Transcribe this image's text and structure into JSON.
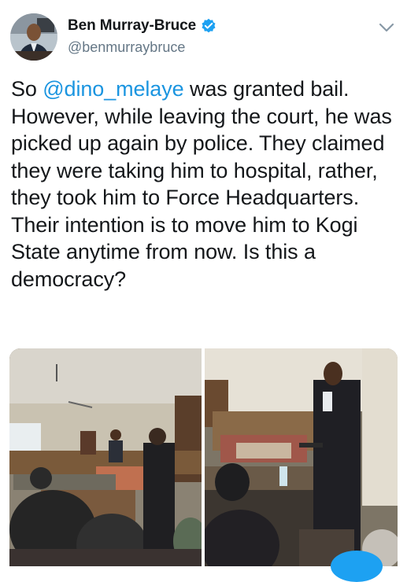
{
  "author": {
    "display_name": "Ben Murray-Bruce",
    "handle": "@benmurraybruce",
    "verified": true,
    "avatar_icon": "profile-photo"
  },
  "menu": {
    "icon": "chevron-down-icon"
  },
  "tweet": {
    "text_before": "So ",
    "mention": "@dino_melaye",
    "text_after": " was granted bail. However, while leaving the court, he was picked up again by police. They claimed they were taking him to hospital, rather, they took him to Force Headquarters. Their intention is to move him to Kogi State anytime from now. Is this a democracy?"
  },
  "media": {
    "photos": [
      {
        "subject": "courtroom-crowd-photo"
      },
      {
        "subject": "courtroom-man-in-suit-photo"
      }
    ]
  },
  "colors": {
    "text": "#14171a",
    "secondary": "#657786",
    "link": "#1b95e0",
    "verified": "#1da1f2"
  }
}
